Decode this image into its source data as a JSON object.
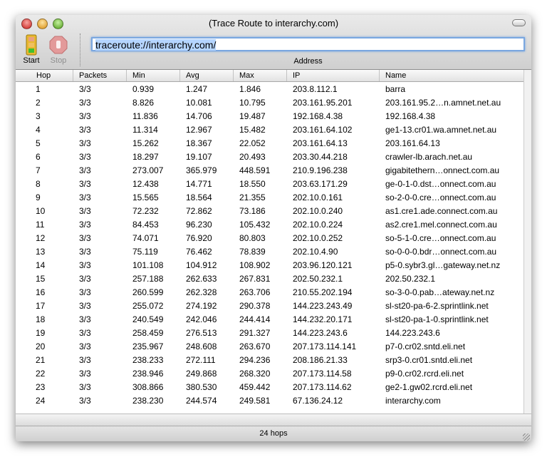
{
  "window": {
    "title": "(Trace Route to interarchy.com)"
  },
  "toolbar": {
    "start_label": "Start",
    "stop_label": "Stop",
    "address_value": "traceroute://interarchy.com/",
    "address_label": "Address"
  },
  "table": {
    "columns": [
      "Hop",
      "Packets",
      "Min",
      "Avg",
      "Max",
      "IP",
      "Name"
    ],
    "rows": [
      [
        "1",
        "3/3",
        "0.939",
        "1.247",
        "1.846",
        "203.8.112.1",
        "barra"
      ],
      [
        "2",
        "3/3",
        "8.826",
        "10.081",
        "10.795",
        "203.161.95.201",
        "203.161.95.2…n.amnet.net.au"
      ],
      [
        "3",
        "3/3",
        "11.836",
        "14.706",
        "19.487",
        "192.168.4.38",
        "192.168.4.38"
      ],
      [
        "4",
        "3/3",
        "11.314",
        "12.967",
        "15.482",
        "203.161.64.102",
        "ge1-13.cr01.wa.amnet.net.au"
      ],
      [
        "5",
        "3/3",
        "15.262",
        "18.367",
        "22.052",
        "203.161.64.13",
        "203.161.64.13"
      ],
      [
        "6",
        "3/3",
        "18.297",
        "19.107",
        "20.493",
        "203.30.44.218",
        "crawler-lb.arach.net.au"
      ],
      [
        "7",
        "3/3",
        "273.007",
        "365.979",
        "448.591",
        "210.9.196.238",
        "gigabitethern…onnect.com.au"
      ],
      [
        "8",
        "3/3",
        "12.438",
        "14.771",
        "18.550",
        "203.63.171.29",
        "ge-0-1-0.dst…onnect.com.au"
      ],
      [
        "9",
        "3/3",
        "15.565",
        "18.564",
        "21.355",
        "202.10.0.161",
        "so-2-0-0.cre…onnect.com.au"
      ],
      [
        "10",
        "3/3",
        "72.232",
        "72.862",
        "73.186",
        "202.10.0.240",
        "as1.cre1.ade.connect.com.au"
      ],
      [
        "11",
        "3/3",
        "84.453",
        "96.230",
        "105.432",
        "202.10.0.224",
        "as2.cre1.mel.connect.com.au"
      ],
      [
        "12",
        "3/3",
        "74.071",
        "76.920",
        "80.803",
        "202.10.0.252",
        "so-5-1-0.cre…onnect.com.au"
      ],
      [
        "13",
        "3/3",
        "75.119",
        "76.462",
        "78.839",
        "202.10.4.90",
        "so-0-0-0.bdr…onnect.com.au"
      ],
      [
        "14",
        "3/3",
        "101.108",
        "104.912",
        "108.902",
        "203.96.120.121",
        "p5-0.sybr3.gl…gateway.net.nz"
      ],
      [
        "15",
        "3/3",
        "257.188",
        "262.633",
        "267.831",
        "202.50.232.1",
        "202.50.232.1"
      ],
      [
        "16",
        "3/3",
        "260.599",
        "262.328",
        "263.706",
        "210.55.202.194",
        "so-3-0-0.pab…ateway.net.nz"
      ],
      [
        "17",
        "3/3",
        "255.072",
        "274.192",
        "290.378",
        "144.223.243.49",
        "sl-st20-pa-6-2.sprintlink.net"
      ],
      [
        "18",
        "3/3",
        "240.549",
        "242.046",
        "244.414",
        "144.232.20.171",
        "sl-st20-pa-1-0.sprintlink.net"
      ],
      [
        "19",
        "3/3",
        "258.459",
        "276.513",
        "291.327",
        "144.223.243.6",
        "144.223.243.6"
      ],
      [
        "20",
        "3/3",
        "235.967",
        "248.608",
        "263.670",
        "207.173.114.141",
        "p7-0.cr02.sntd.eli.net"
      ],
      [
        "21",
        "3/3",
        "238.233",
        "272.111",
        "294.236",
        "208.186.21.33",
        "srp3-0.cr01.sntd.eli.net"
      ],
      [
        "22",
        "3/3",
        "238.946",
        "249.868",
        "268.320",
        "207.173.114.58",
        "p9-0.cr02.rcrd.eli.net"
      ],
      [
        "23",
        "3/3",
        "308.866",
        "380.530",
        "459.442",
        "207.173.114.62",
        "ge2-1.gw02.rcrd.eli.net"
      ],
      [
        "24",
        "3/3",
        "238.230",
        "244.574",
        "249.581",
        "67.136.24.12",
        "interarchy.com"
      ]
    ]
  },
  "status": {
    "text": "24 hops"
  }
}
